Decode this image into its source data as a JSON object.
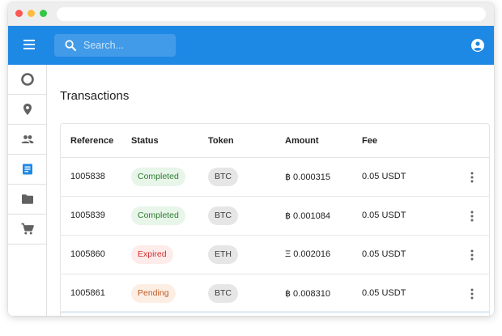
{
  "search": {
    "placeholder": "Search..."
  },
  "page": {
    "title": "Transactions"
  },
  "table": {
    "headers": {
      "reference": "Reference",
      "status": "Status",
      "token": "Token",
      "amount": "Amount",
      "fee": "Fee"
    },
    "rows": [
      {
        "reference": "1005838",
        "status": "Completed",
        "token": "BTC",
        "amount": "฿ 0.000315",
        "fee": "0.05 USDT"
      },
      {
        "reference": "1005839",
        "status": "Completed",
        "token": "BTC",
        "amount": "฿ 0.001084",
        "fee": "0.05 USDT"
      },
      {
        "reference": "1005860",
        "status": "Expired",
        "token": "ETH",
        "amount": "Ξ 0.002016",
        "fee": "0.05 USDT"
      },
      {
        "reference": "1005861",
        "status": "Pending",
        "token": "BTC",
        "amount": "฿ 0.008310",
        "fee": "0.05 USDT"
      }
    ]
  },
  "colors": {
    "appbar": "#1e88e5",
    "active_nav": "#1e88e5",
    "status_completed_bg": "#e8f5e9",
    "status_completed_fg": "#2e7d32",
    "status_expired_bg": "#fdecea",
    "status_expired_fg": "#d32f2f",
    "status_pending_bg": "#fdeee4",
    "status_pending_fg": "#bf5a24"
  },
  "icons": {
    "appbar": [
      "menu-icon",
      "search-icon",
      "account-circle-icon"
    ],
    "sidebar": [
      "circle-outline-icon",
      "location-pin-icon",
      "people-icon",
      "document-icon",
      "folder-icon",
      "cart-icon"
    ],
    "row_action": "more-vertical-icon"
  }
}
